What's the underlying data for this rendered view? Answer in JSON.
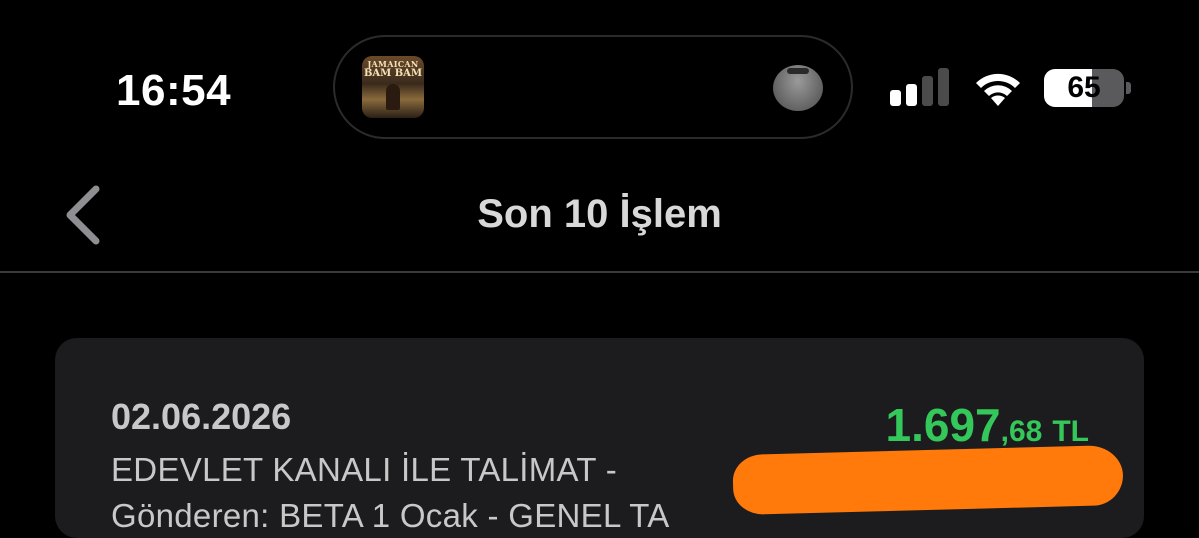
{
  "status_bar": {
    "time": "16:54",
    "battery_percent": "65",
    "signal_bars_active": 2,
    "signal_bars_total": 4
  },
  "dynamic_island": {
    "app_thumbnail_line1": "JAMAICAN",
    "app_thumbnail_line2": "BAM BAM"
  },
  "nav": {
    "title": "Son 10 İşlem"
  },
  "transaction": {
    "date": "02.06.2026",
    "description_line1": "EDEVLET KANALI İLE TALİMAT -",
    "description_line2": "Gönderen: BETA 1 Ocak - GENEL TA",
    "amount_main": "1.697",
    "amount_decimal": ",68",
    "currency": "TL"
  },
  "colors": {
    "background": "#000000",
    "card": "#1c1c1e",
    "amount_positive": "#34c759",
    "redaction": "#ff7a0a"
  }
}
